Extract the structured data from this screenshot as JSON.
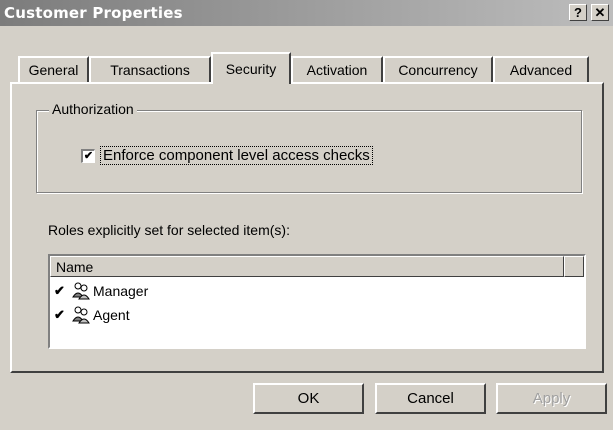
{
  "window": {
    "title": "Customer Properties",
    "help_label": "?",
    "close_label": "✕"
  },
  "tabs": [
    {
      "label": "General",
      "active": false
    },
    {
      "label": "Transactions",
      "active": false
    },
    {
      "label": "Security",
      "active": true
    },
    {
      "label": "Activation",
      "active": false
    },
    {
      "label": "Concurrency",
      "active": false
    },
    {
      "label": "Advanced",
      "active": false
    }
  ],
  "authorization": {
    "group_label": "Authorization",
    "enforce_checkbox": {
      "label": "Enforce component level access checks",
      "checked": true,
      "mark": "✔"
    }
  },
  "roles": {
    "label": "Roles explicitly set for selected item(s):",
    "column_header": "Name",
    "items": [
      {
        "name": "Manager",
        "checked": true,
        "mark": "✔",
        "icon": "role-users-icon"
      },
      {
        "name": "Agent",
        "checked": true,
        "mark": "✔",
        "icon": "role-users-icon"
      }
    ]
  },
  "buttons": {
    "ok": "OK",
    "cancel": "Cancel",
    "apply": "Apply"
  },
  "colors": {
    "face": "#d4d0c8",
    "title_gradient_start": "#7c7c7c",
    "title_gradient_end": "#bdbdbd"
  }
}
